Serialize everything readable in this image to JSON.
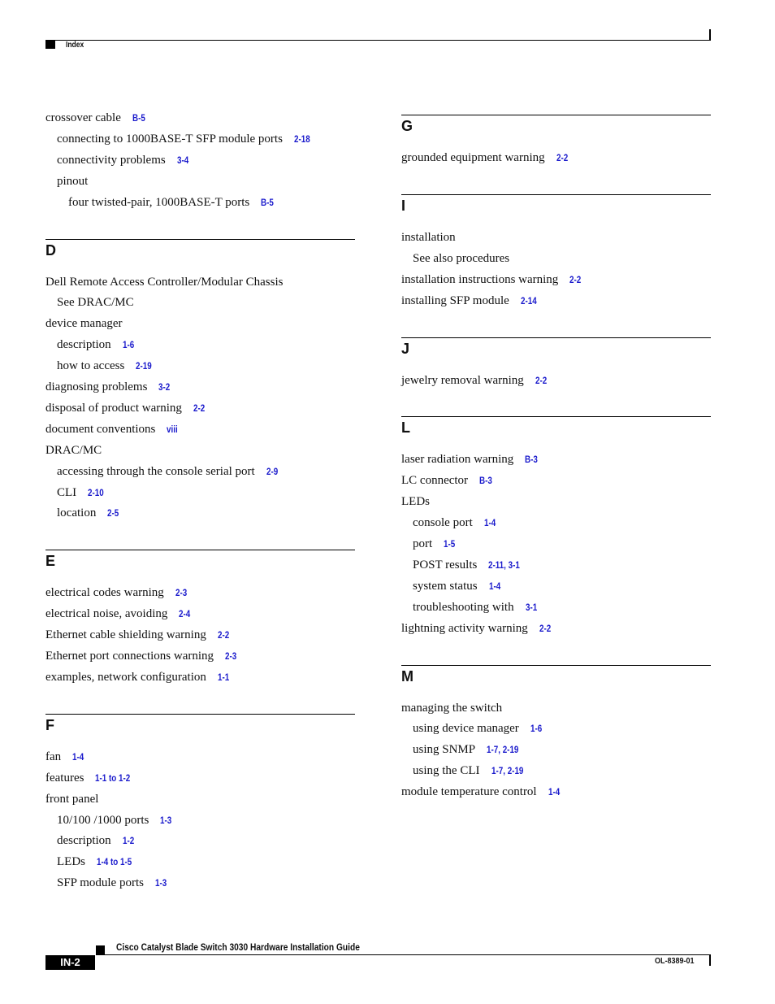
{
  "header": {
    "section_title": "Index"
  },
  "left_column": [
    {
      "type": "entry",
      "level": 1,
      "text": "crossover cable",
      "refs": "B-5"
    },
    {
      "type": "entry",
      "level": 2,
      "text": "connecting to 1000BASE-T SFP module ports",
      "refs": "2-18"
    },
    {
      "type": "entry",
      "level": 2,
      "text": "connectivity problems",
      "refs": "3-4"
    },
    {
      "type": "entry",
      "level": 2,
      "text": "pinout",
      "refs": ""
    },
    {
      "type": "entry",
      "level": 3,
      "text": "four twisted-pair, 1000BASE-T ports",
      "refs": "B-5"
    },
    {
      "type": "section",
      "letter": "D"
    },
    {
      "type": "entry",
      "level": 1,
      "text": " Dell Remote Access Controller/Modular Chassis",
      "refs": ""
    },
    {
      "type": "entry",
      "level": 2,
      "text": "See DRAC/MC",
      "refs": ""
    },
    {
      "type": "entry",
      "level": 1,
      "text": "device manager",
      "refs": ""
    },
    {
      "type": "entry",
      "level": 2,
      "text": "description",
      "refs": "1-6"
    },
    {
      "type": "entry",
      "level": 2,
      "text": "how to access",
      "refs": "2-19"
    },
    {
      "type": "entry",
      "level": 1,
      "text": "diagnosing problems",
      "refs": "3-2"
    },
    {
      "type": "entry",
      "level": 1,
      "text": "disposal of product warning",
      "refs": "2-2"
    },
    {
      "type": "entry",
      "level": 1,
      "text": "document conventions",
      "refs": "viii"
    },
    {
      "type": "entry",
      "level": 1,
      "text": "DRAC/MC",
      "refs": ""
    },
    {
      "type": "entry",
      "level": 2,
      "text": "accessing through the console serial port",
      "refs": "2-9"
    },
    {
      "type": "entry",
      "level": 2,
      "text": "CLI",
      "refs": "2-10"
    },
    {
      "type": "entry",
      "level": 2,
      "text": "location",
      "refs": "2-5"
    },
    {
      "type": "section",
      "letter": "E"
    },
    {
      "type": "entry",
      "level": 1,
      "text": "electrical codes warning",
      "refs": "2-3"
    },
    {
      "type": "entry",
      "level": 1,
      "text": "electrical noise, avoiding",
      "refs": "2-4"
    },
    {
      "type": "entry",
      "level": 1,
      "text": "Ethernet cable shielding warning",
      "refs": "2-2"
    },
    {
      "type": "entry",
      "level": 1,
      "text": "Ethernet port connections warning",
      "refs": "2-3"
    },
    {
      "type": "entry",
      "level": 1,
      "text": "examples, network configuration",
      "refs": "1-1"
    },
    {
      "type": "section",
      "letter": "F"
    },
    {
      "type": "entry",
      "level": 1,
      "text": "fan",
      "refs": "1-4"
    },
    {
      "type": "entry",
      "level": 1,
      "text": "features",
      "refs": "1-1 to 1-2"
    },
    {
      "type": "entry",
      "level": 1,
      "text": "front panel",
      "refs": ""
    },
    {
      "type": "entry",
      "level": 2,
      "text": "10/100 /1000 ports",
      "refs": "1-3"
    },
    {
      "type": "entry",
      "level": 2,
      "text": "description",
      "refs": "1-2"
    },
    {
      "type": "entry",
      "level": 2,
      "text": "LEDs",
      "refs": "1-4 to 1-5"
    },
    {
      "type": "entry",
      "level": 2,
      "text": "SFP module ports",
      "refs": "1-3"
    }
  ],
  "right_column": [
    {
      "type": "section",
      "letter": "G"
    },
    {
      "type": "entry",
      "level": 1,
      "text": "grounded equipment warning",
      "refs": "2-2"
    },
    {
      "type": "section",
      "letter": "I"
    },
    {
      "type": "entry",
      "level": 1,
      "text": "installation",
      "refs": ""
    },
    {
      "type": "entry",
      "level": 2,
      "text": "See also procedures",
      "refs": ""
    },
    {
      "type": "entry",
      "level": 1,
      "text": "installation instructions warning",
      "refs": "2-2"
    },
    {
      "type": "entry",
      "level": 1,
      "text": "installing SFP module",
      "refs": "2-14"
    },
    {
      "type": "section",
      "letter": "J"
    },
    {
      "type": "entry",
      "level": 1,
      "text": "jewelry removal warning",
      "refs": "2-2"
    },
    {
      "type": "section",
      "letter": "L"
    },
    {
      "type": "entry",
      "level": 1,
      "text": "laser radiation warning",
      "refs": "B-3"
    },
    {
      "type": "entry",
      "level": 1,
      "text": "LC connector",
      "refs": "B-3"
    },
    {
      "type": "entry",
      "level": 1,
      "text": "LEDs",
      "refs": ""
    },
    {
      "type": "entry",
      "level": 2,
      "text": "console port",
      "refs": "1-4"
    },
    {
      "type": "entry",
      "level": 2,
      "text": "port",
      "refs": "1-5"
    },
    {
      "type": "entry",
      "level": 2,
      "text": "POST results",
      "refs": "2-11, 3-1"
    },
    {
      "type": "entry",
      "level": 2,
      "text": "system status",
      "refs": "1-4"
    },
    {
      "type": "entry",
      "level": 2,
      "text": "troubleshooting with",
      "refs": "3-1"
    },
    {
      "type": "entry",
      "level": 1,
      "text": "lightning activity warning",
      "refs": "2-2"
    },
    {
      "type": "section",
      "letter": "M"
    },
    {
      "type": "entry",
      "level": 1,
      "text": "managing the switch",
      "refs": ""
    },
    {
      "type": "entry",
      "level": 2,
      "text": "using device manager",
      "refs": "1-6"
    },
    {
      "type": "entry",
      "level": 2,
      "text": "using SNMP",
      "refs": "1-7, 2-19"
    },
    {
      "type": "entry",
      "level": 2,
      "text": "using the CLI",
      "refs": "1-7, 2-19"
    },
    {
      "type": "entry",
      "level": 1,
      "text": "module temperature control",
      "refs": "1-4"
    }
  ],
  "footer": {
    "book_title": "Cisco Catalyst Blade Switch 3030 Hardware Installation Guide",
    "page_number": "IN-2",
    "doc_number": "OL-8389-01"
  },
  "colors": {
    "link": "#1a1acc",
    "text": "#111111",
    "rule": "#000000"
  }
}
